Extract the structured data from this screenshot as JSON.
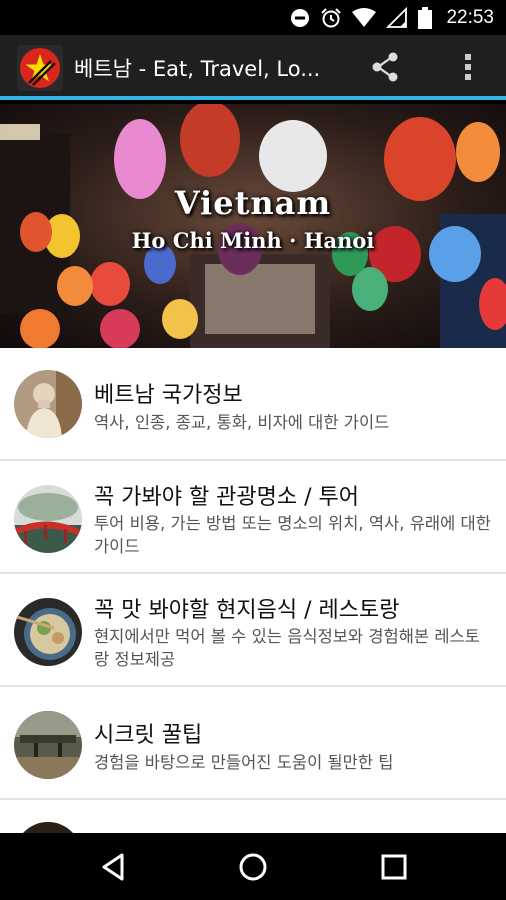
{
  "status_bar": {
    "time": "22:53",
    "icons": [
      "do-not-disturb-icon",
      "alarm-icon",
      "wifi-icon",
      "signal-icon",
      "battery-icon"
    ]
  },
  "app_bar": {
    "title": "베트남 - Eat, Travel, Lo...",
    "logo": "vietnam-flag-logo",
    "actions": [
      "share-icon",
      "overflow-menu-icon"
    ]
  },
  "hero": {
    "title": "Vietnam",
    "subtitle": "Ho Chi Minh · Hanoi"
  },
  "list": {
    "items": [
      {
        "title": "베트남 국가정보",
        "desc": "역사, 인종, 종교, 통화, 비자에 대한 가이드"
      },
      {
        "title": "꼭 가봐야 할 관광명소 / 투어",
        "desc": "투어 비용, 가는 방법 또는 명소의 위치, 역사, 유래에 대한 가이드"
      },
      {
        "title": "꼭 맛 봐야할 현지음식 / 레스토랑",
        "desc": "현지에서만 먹어 볼 수 있는 음식정보와 경험해본 레스토랑 정보제공"
      },
      {
        "title": "시크릿 꿀팁",
        "desc": "경험을 바탕으로 만들어진 도움이 될만한 팁"
      }
    ]
  },
  "nav_bar": {
    "buttons": [
      "back-icon",
      "home-icon",
      "recents-icon"
    ]
  },
  "colors": {
    "accent": "#33b5e5",
    "app_bar": "#1f1f1f",
    "flag_red": "#da251d",
    "flag_star": "#ffdd00"
  }
}
